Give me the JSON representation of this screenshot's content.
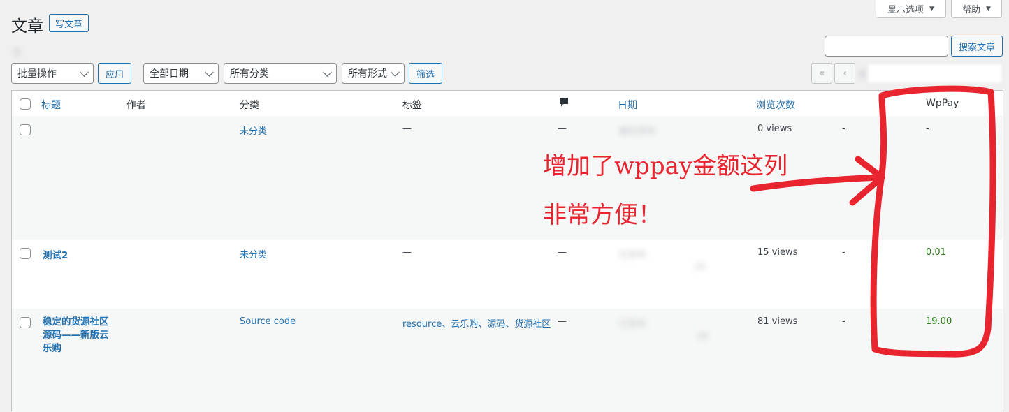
{
  "top_buttons": {
    "screen_options": "显示选项",
    "help": "帮助"
  },
  "page": {
    "title": "文章",
    "add_new": "写文章",
    "subsubsub": "全"
  },
  "filters": {
    "bulk_action": "批量操作",
    "apply": "应用",
    "dates": "全部日期",
    "categories": "所有分类",
    "formats": "所有形式",
    "filter": "筛选"
  },
  "search": {
    "button": "搜索文章",
    "value": ""
  },
  "pagination": {
    "first": "«",
    "prev": "‹",
    "label": "第"
  },
  "columns": {
    "title": "标题",
    "author": "作者",
    "category": "分类",
    "tags": "标签",
    "date": "日期",
    "views": "浏览次数",
    "wppay": "WpPay"
  },
  "rows": [
    {
      "title": "",
      "category": "未分类",
      "tags": "—",
      "comments": "—",
      "date_status": "最后修改",
      "views": "0 views",
      "extra": "-",
      "wppay": "-"
    },
    {
      "title": "测试2",
      "category": "未分类",
      "tags": "—",
      "comments": "—",
      "date_status": "已发布",
      "date_frag": "24",
      "views": "15 views",
      "extra": "-",
      "wppay": "0.01"
    },
    {
      "title": "稳定的货源社区源码——新版云乐购",
      "category": "Source code",
      "tags": "resource、云乐购、源码、货源社区",
      "comments": "—",
      "date_status": "已发布",
      "date_frag": "39",
      "views": "81 views",
      "extra": "-",
      "wppay": "19.00"
    }
  ],
  "annotation": {
    "line1": "增加了wppay金额这列",
    "line2": "非常方便！",
    "color": "#e8242f"
  },
  "colors": {
    "link": "#2271b1",
    "price": "#2e7d1a",
    "background": "#f0f0f1"
  }
}
